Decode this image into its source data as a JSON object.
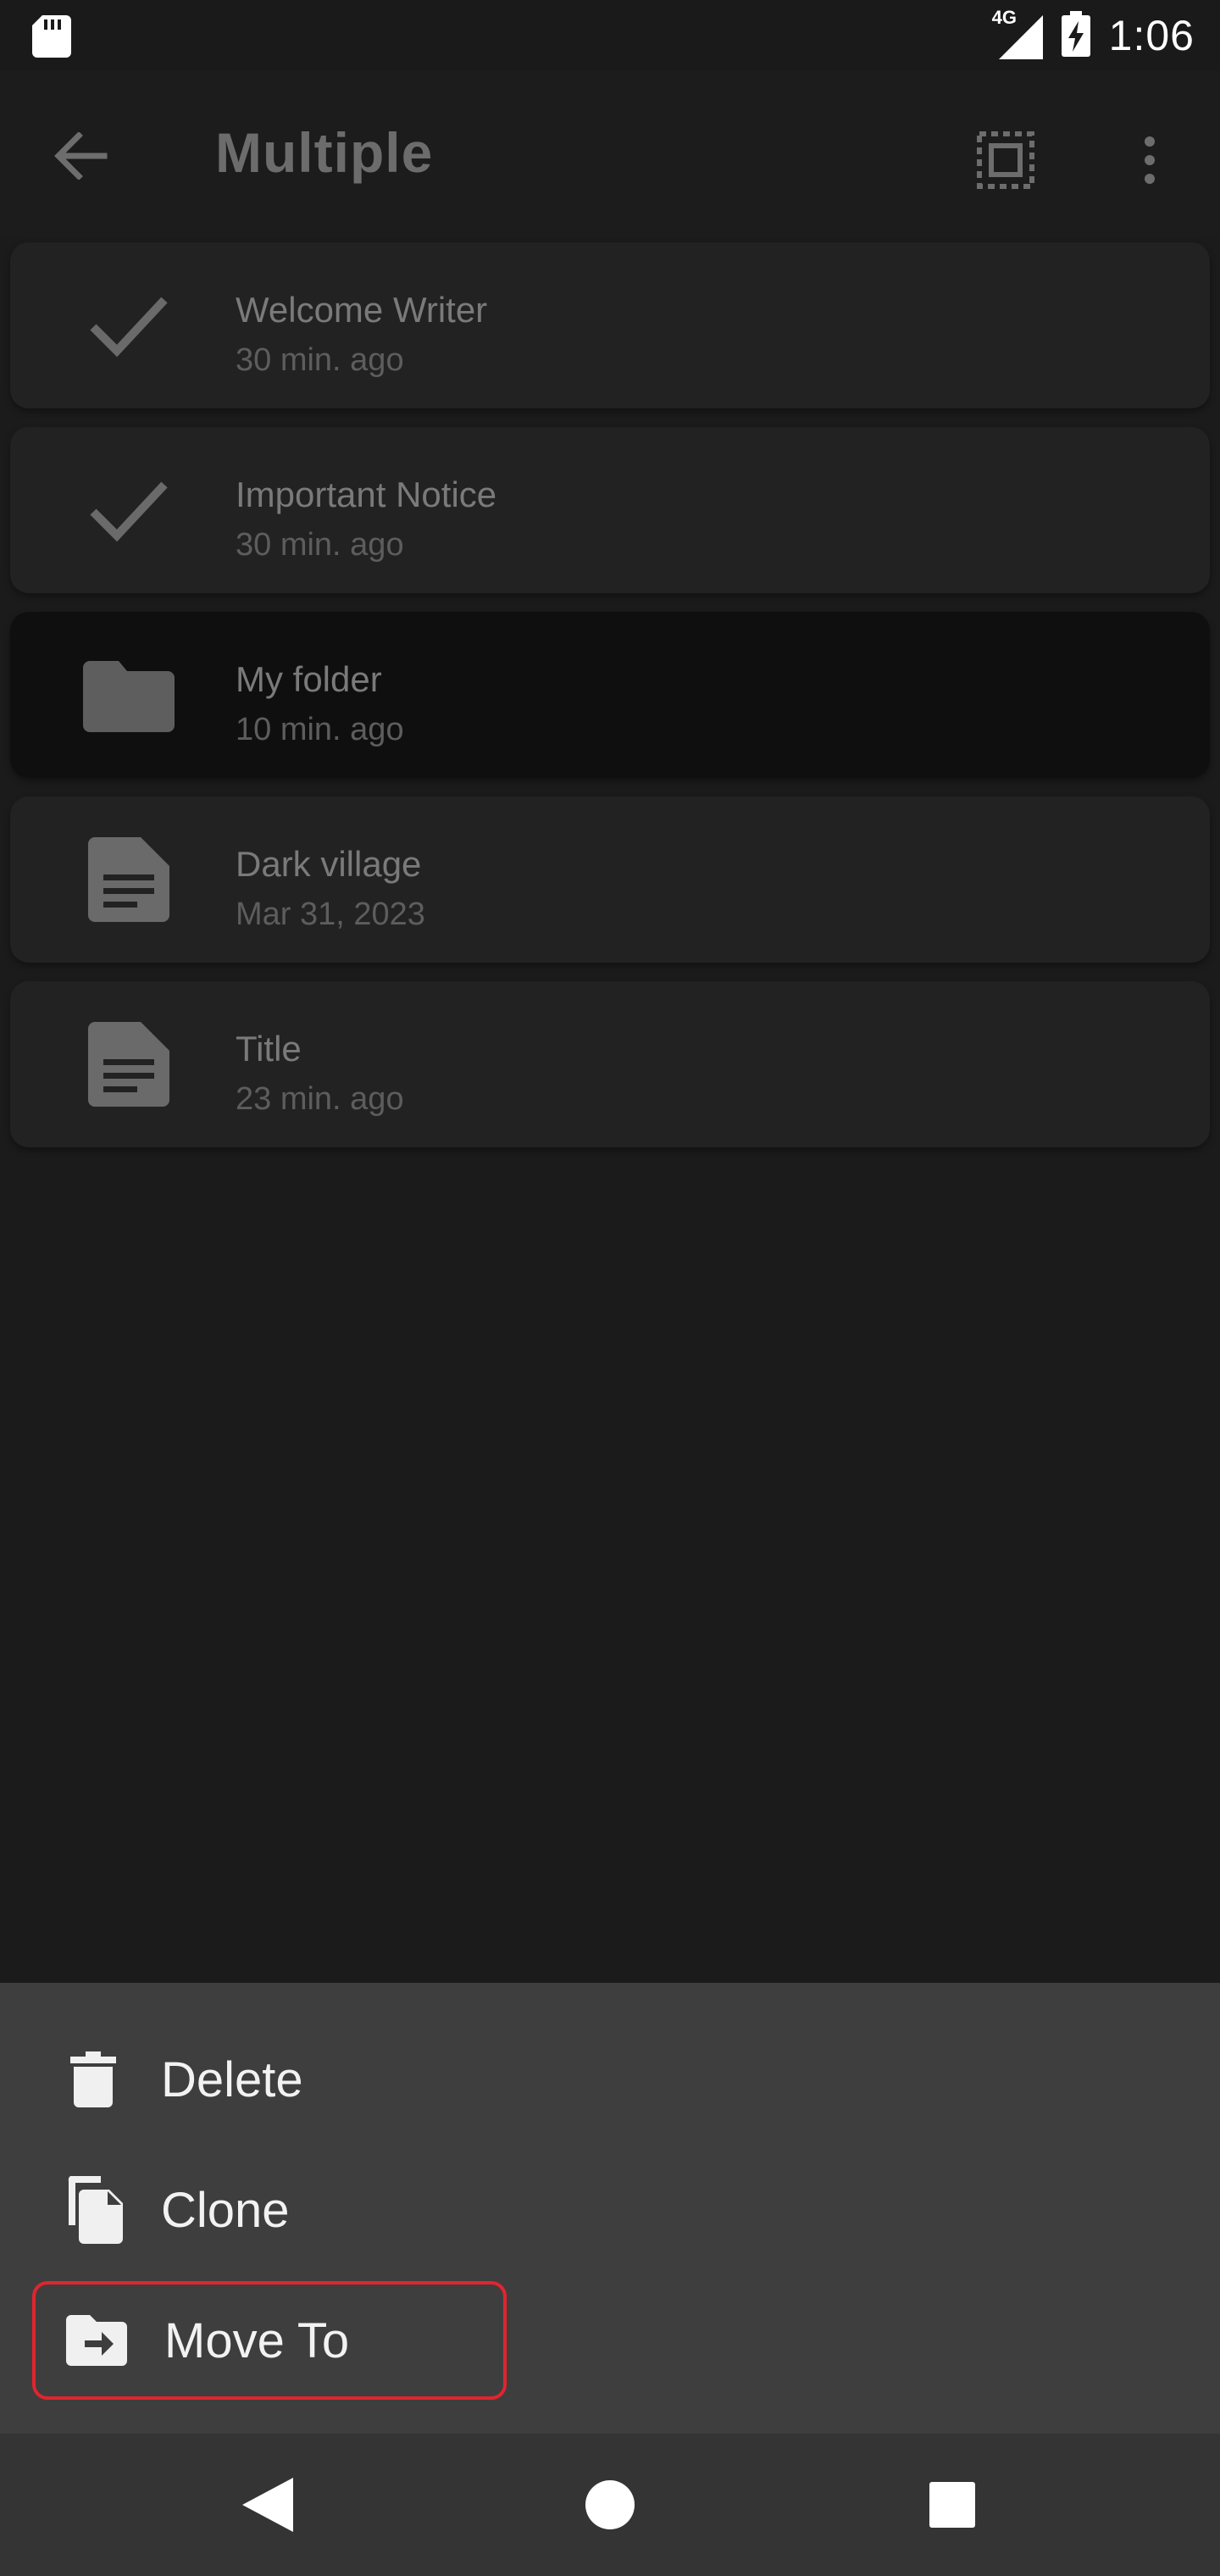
{
  "status_bar": {
    "network_type": "4G",
    "time": "1:06"
  },
  "app_bar": {
    "title": "Multiple"
  },
  "items": [
    {
      "title": "Welcome Writer",
      "subtitle": "30 min. ago",
      "icon": "check-icon",
      "selected": true
    },
    {
      "title": "Important Notice",
      "subtitle": "30 min. ago",
      "icon": "check-icon",
      "selected": true
    },
    {
      "title": "My folder",
      "subtitle": "10 min. ago",
      "icon": "folder-icon",
      "selected": false
    },
    {
      "title": "Dark village",
      "subtitle": "Mar 31, 2023",
      "icon": "document-icon",
      "selected": false
    },
    {
      "title": "Title",
      "subtitle": "23 min. ago",
      "icon": "document-icon",
      "selected": false
    }
  ],
  "actions": {
    "delete_label": "Delete",
    "clone_label": "Clone",
    "move_label": "Move To"
  },
  "colors": {
    "highlight": "#e0252f",
    "sheet_background": "#3e3e3e"
  }
}
